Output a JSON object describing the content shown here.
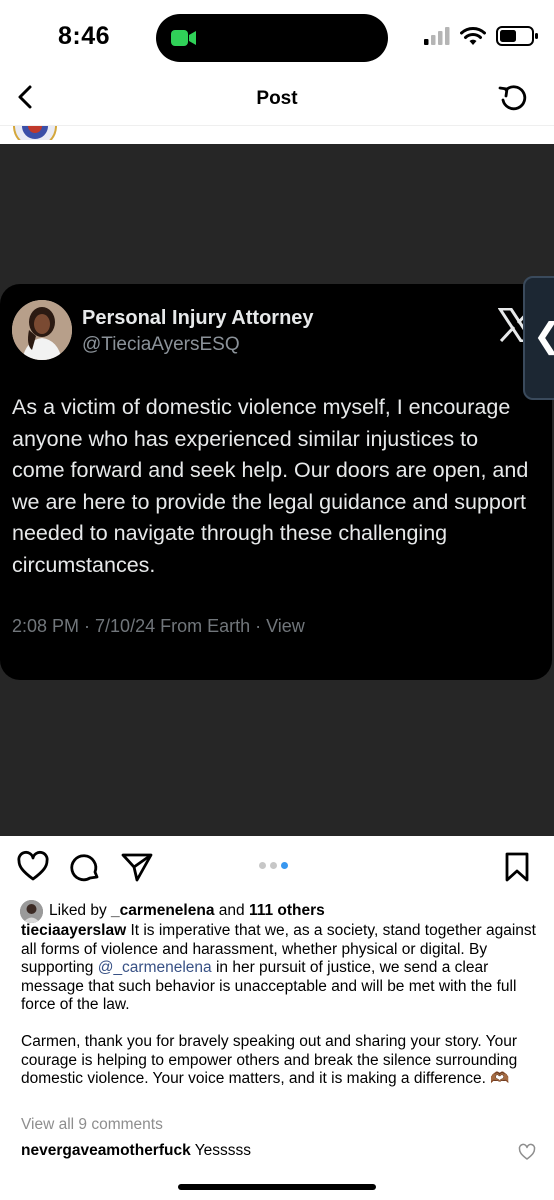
{
  "status_bar": {
    "time": "8:46"
  },
  "nav": {
    "title": "Post"
  },
  "tweet": {
    "name": "Personal Injury Attorney",
    "handle": "@TieciaAyersESQ",
    "body": "As a victim of domestic violence myself, I encourage anyone who has experienced similar injustices to come forward and seek help. Our doors are open, and we are here to provide the legal guidance and support needed to navigate through these challenging circumstances.",
    "meta": "2:08 PM · 7/10/24 From Earth · View",
    "side_tab_glyph": "❮"
  },
  "carousel": {
    "count": 3,
    "active": 2
  },
  "likes": {
    "prefix": "Liked by ",
    "user": "_carmenelena",
    "middle": " and ",
    "others": "111 others"
  },
  "caption": {
    "user": "tieciaayerslaw",
    "text_before": " It is imperative that we, as a society, stand together against all forms of violence and harassment, whether physical or digital. By supporting ",
    "mention": "@_carmenelena",
    "text_after": " in her pursuit of justice, we send a clear message that such behavior is unacceptable and will be met with the full force of the law.",
    "paragraph2": "Carmen, thank you for bravely speaking out and sharing your story. Your courage is helping to empower others and break the silence surrounding domestic violence. Your voice matters, and it is making a difference. 🫶🏾"
  },
  "comments": {
    "view_all": "View all 9 comments",
    "first_user": "nevergaveamotherfuck",
    "first_text": " Yesssss"
  },
  "colors": {
    "mention": "#385185",
    "tweet_bg": "#000000",
    "image_bg": "#262626",
    "dot_active": "#3897f0"
  }
}
